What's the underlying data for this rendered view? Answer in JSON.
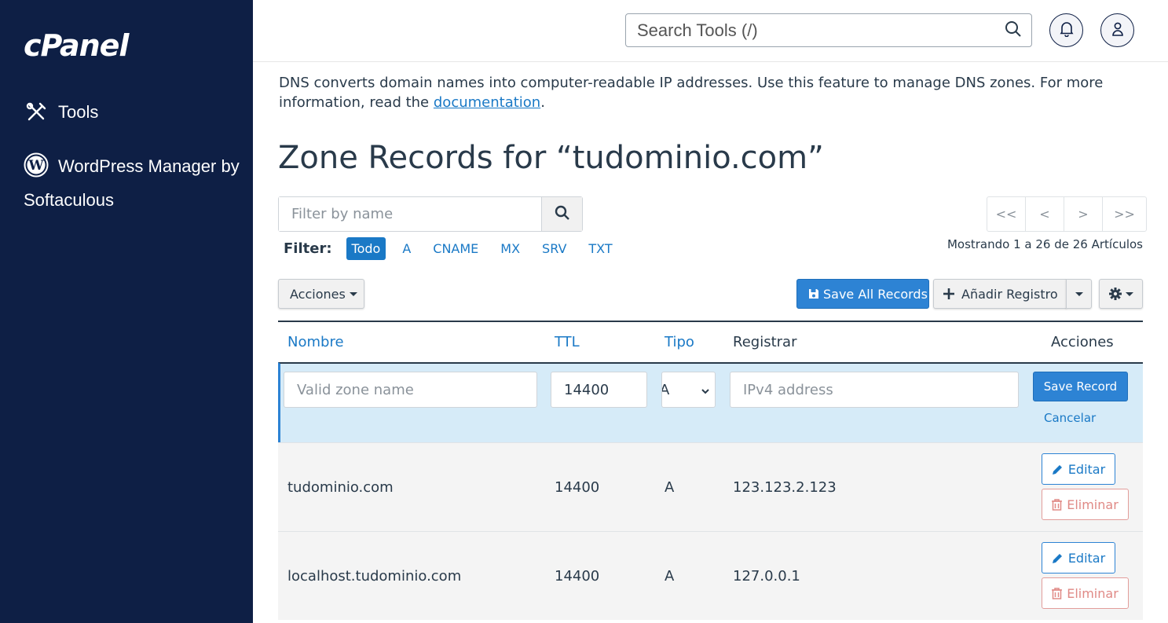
{
  "sidebar": {
    "logo": "cPanel",
    "items": [
      {
        "label": "Tools",
        "icon": "tools-icon"
      },
      {
        "label": "WordPress Manager by Softaculous",
        "icon": "wordpress-icon"
      }
    ]
  },
  "topbar": {
    "search_placeholder": "Search Tools (/)",
    "icons": [
      "search-icon",
      "bell-icon",
      "user-icon"
    ]
  },
  "main": {
    "description": "DNS converts domain names into computer-readable IP addresses. Use this feature to manage DNS zones. For more information, read the",
    "doc_link": "documentation",
    "description_end": ".",
    "title": "Zone Records for “tudominio.com”",
    "filter_placeholder": "Filter by name",
    "filter_label": "Filter:",
    "filter_options": [
      "Todo",
      "A",
      "CNAME",
      "MX",
      "SRV",
      "TXT"
    ],
    "filter_active": "Todo",
    "pager": [
      "<<",
      "<",
      ">",
      ">>"
    ],
    "showing": "Mostrando 1 a 26 de 26 Artículos",
    "actions_label": "Acciones",
    "save_all_label": "Save All Records",
    "add_record_label": "Añadir Registro"
  },
  "table": {
    "headers": {
      "name": "Nombre",
      "ttl": "TTL",
      "type": "Tipo",
      "record": "Registrar",
      "actions": "Acciones"
    },
    "edit_row": {
      "name_placeholder": "Valid zone name",
      "ttl_value": "14400",
      "type_value": "A",
      "record_placeholder": "IPv4 address",
      "save_label": "Save Record",
      "cancel_label": "Cancelar"
    },
    "rows": [
      {
        "name": "tudominio.com",
        "ttl": "14400",
        "type": "A",
        "record": "123.123.2.123"
      },
      {
        "name": "localhost.tudominio.com",
        "ttl": "14400",
        "type": "A",
        "record": "127.0.0.1"
      }
    ],
    "edit_label": "Editar",
    "delete_label": "Eliminar"
  },
  "colors": {
    "sidebar_bg": "#0e1f45",
    "accent": "#1a79c6",
    "primary_btn": "#2d83d4",
    "danger": "#e08a86",
    "edit_row_bg": "#d6ebf8"
  }
}
